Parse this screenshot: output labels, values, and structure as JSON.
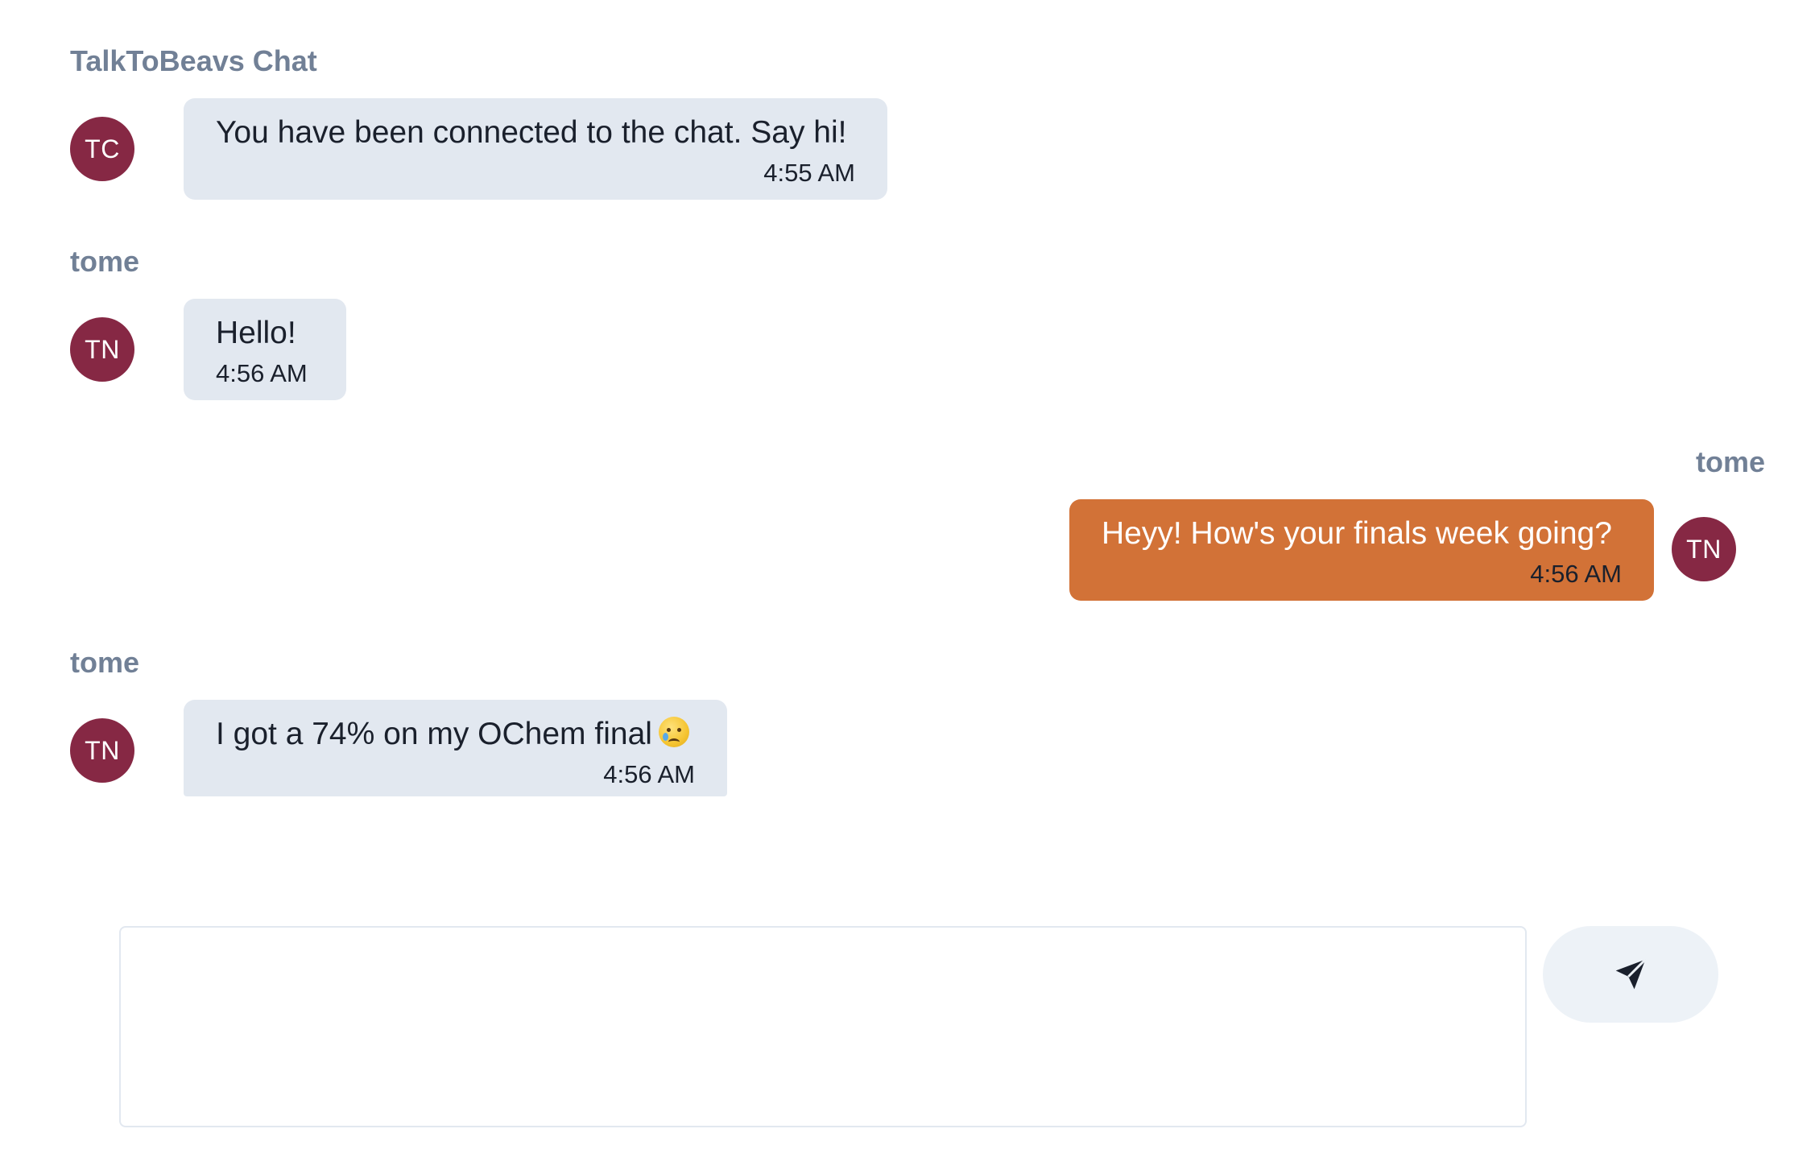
{
  "messages": [
    {
      "sender": "TalkToBeavs Chat",
      "initials": "TC",
      "text": "You have been connected to the chat. Say hi!",
      "time": "4:55 AM",
      "direction": "incoming"
    },
    {
      "sender": "tome",
      "initials": "TN",
      "text": "Hello!",
      "time": "4:56 AM",
      "direction": "incoming"
    },
    {
      "sender": "tome",
      "initials": "TN",
      "text": "Heyy! How's your finals week going?",
      "time": "4:56 AM",
      "direction": "outgoing"
    },
    {
      "sender": "tome",
      "initials": "TN",
      "text": "I got a 74% on my OChem final",
      "emoji": "crying-face-emoji",
      "time": "4:56 AM",
      "direction": "incoming"
    }
  ],
  "composer": {
    "placeholder": "",
    "value": "",
    "send_icon": "send-icon"
  },
  "colors": {
    "avatar": "#862844",
    "outgoing_bubble": "#d27237",
    "incoming_bubble": "#e2e8f0",
    "sender_label": "#718096",
    "send_button": "#edf2f7"
  }
}
